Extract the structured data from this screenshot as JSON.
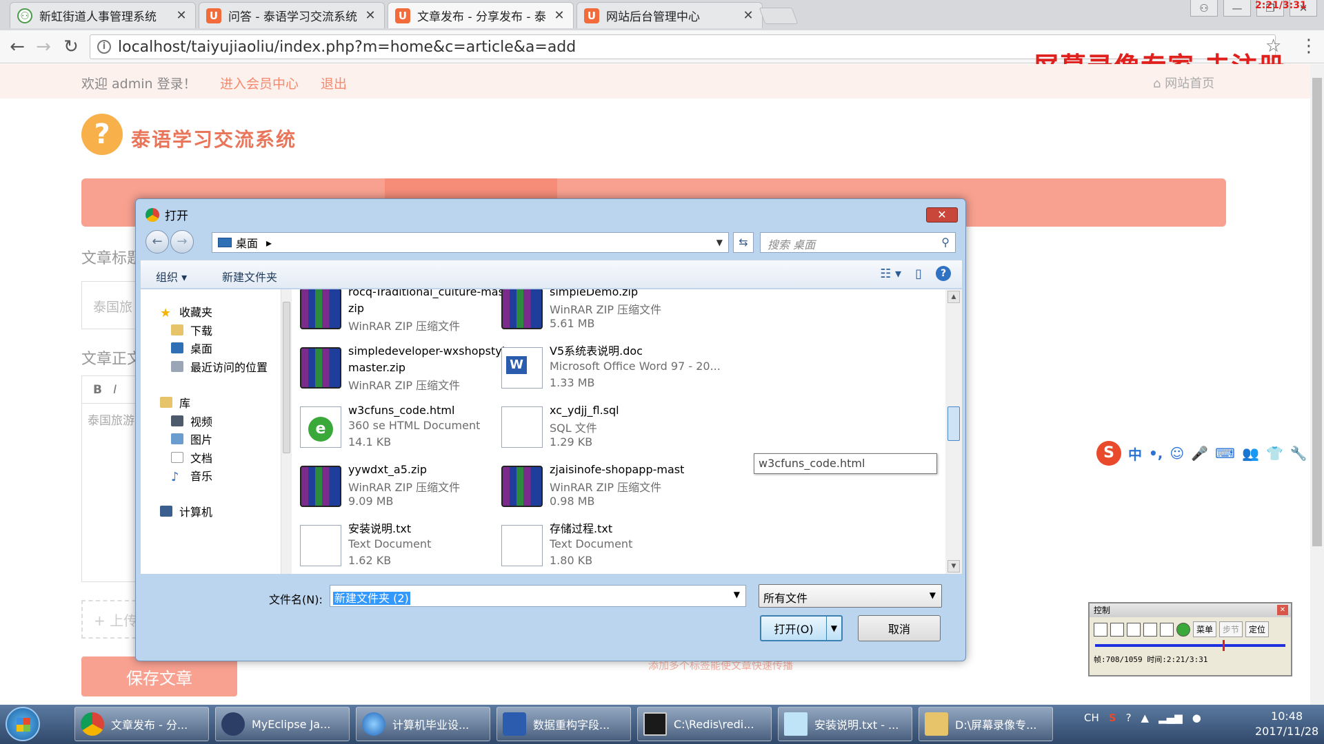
{
  "browser": {
    "tabs": [
      {
        "label": "新虹街道人事管理系统",
        "favicon": "person-icon"
      },
      {
        "label": "问答 - 泰语学习交流系统",
        "favicon": "U"
      },
      {
        "label": "文章发布 - 分享发布 - 泰",
        "favicon": "U"
      },
      {
        "label": "网站后台管理中心",
        "favicon": "U"
      }
    ],
    "url": "localhost/taiyujiaoliu/index.php?m=home&c=article&a=add"
  },
  "watermark": {
    "text": "屏幕录像专家  未注册",
    "time": "2:21/3:31"
  },
  "site": {
    "welcome": "欢迎  admin  登录！",
    "member_link": "进入会员中心",
    "logout_link": "退出",
    "home_link": "网站首页",
    "logo_text": "泰语学习交流系统",
    "title_label": "文章标题",
    "title_value": "泰国旅",
    "content_label": "文章正文",
    "content_value": "泰国旅游",
    "upload_label": "+ 上传",
    "save_button": "保存文章",
    "hint": "添加多个标签能使文章快速传播"
  },
  "dialog": {
    "title": "打开",
    "path": "桌面",
    "search_placeholder": "搜索 桌面",
    "organize": "组织 ▾",
    "new_folder": "新建文件夹",
    "nav": {
      "favorites": "收藏夹",
      "downloads": "下载",
      "desktop": "桌面",
      "recent": "最近访问的位置",
      "libraries": "库",
      "videos": "视频",
      "pictures": "图片",
      "documents": "文档",
      "music": "音乐",
      "computer": "计算机"
    },
    "files": [
      {
        "name": "rocq-Traditional_culture-master.zip",
        "name_l1": "rocq-Traditional_culture-master.",
        "name_l2": "zip",
        "type": "WinRAR ZIP 压缩文件",
        "size": "",
        "icon": "winrar-icon"
      },
      {
        "name": "simpleDemo.zip",
        "name_l1": "simpleDemo.zip",
        "name_l2": "",
        "type": "WinRAR ZIP 压缩文件",
        "size": "5.61 MB",
        "icon": "winrar-icon"
      },
      {
        "name": "simpledeveloper-wxshopstyle-master.zip",
        "name_l1": "simpledeveloper-wxshopstyle-",
        "name_l2": "master.zip",
        "type": "WinRAR ZIP 压缩文件",
        "size": "",
        "icon": "winrar-icon"
      },
      {
        "name": "V5系统表说明.doc",
        "name_l1": "V5系统表说明.doc",
        "name_l2": "",
        "type": "Microsoft Office Word 97 - 20...",
        "size": "1.33 MB",
        "icon": "word-doc-icon"
      },
      {
        "name": "w3cfuns_code.html",
        "name_l1": "w3cfuns_code.html",
        "name_l2": "",
        "type": "360 se HTML Document",
        "size": "14.1 KB",
        "icon": "html-file-icon"
      },
      {
        "name": "xc_ydjj_fl.sql",
        "name_l1": "xc_ydjj_fl.sql",
        "name_l2": "",
        "type": "SQL 文件",
        "size": "1.29 KB",
        "icon": "sql-file-icon"
      },
      {
        "name": "yywdxt_a5.zip",
        "name_l1": "yywdxt_a5.zip",
        "name_l2": "",
        "type": "WinRAR ZIP 压缩文件",
        "size": "9.09 MB",
        "icon": "winrar-icon"
      },
      {
        "name": "zjaisinofe-shopapp-mast",
        "name_l1": "zjaisinofe-shopapp-mast",
        "name_l2": "",
        "type": "WinRAR ZIP 压缩文件",
        "size": "0.98 MB",
        "icon": "winrar-icon"
      },
      {
        "name": "安装说明.txt",
        "name_l1": "安装说明.txt",
        "name_l2": "",
        "type": "Text Document",
        "size": "1.62 KB",
        "icon": "text-file-icon"
      },
      {
        "name": "存储过程.txt",
        "name_l1": "存储过程.txt",
        "name_l2": "",
        "type": "Text Document",
        "size": "1.80 KB",
        "icon": "text-file-icon"
      }
    ],
    "tooltip": "w3cfuns_code.html",
    "filename_label": "文件名(N):",
    "filename_value": "新建文件夹 (2)",
    "filter": "所有文件",
    "open_button": "打开(O)",
    "cancel_button": "取消"
  },
  "ime": {
    "items": [
      "中",
      "•,",
      "☺",
      "🎤",
      "⌨",
      "👥",
      "👕",
      "🔧"
    ]
  },
  "recorder": {
    "title": "控制",
    "menu": "菜单",
    "step": "步节",
    "locate": "定位",
    "status": "帧:708/1059 时间:2:21/3:31",
    "progress": 0.67
  },
  "taskbar": {
    "items": [
      {
        "label": "文章发布 - 分...",
        "icon": "chrome-icon"
      },
      {
        "label": "MyEclipse Ja...",
        "icon": "myeclipse-icon"
      },
      {
        "label": "计算机毕业设...",
        "icon": "globe-icon"
      },
      {
        "label": "数据重构字段...",
        "icon": "word-icon"
      },
      {
        "label": "C:\\Redis\\redi...",
        "icon": "console-icon"
      },
      {
        "label": "安装说明.txt - ...",
        "icon": "notepad-icon"
      },
      {
        "label": "D:\\屏幕录像专...",
        "icon": "folder-icon"
      }
    ],
    "tray_lang": "CH",
    "time": "10:48",
    "date": "2017/11/28"
  }
}
